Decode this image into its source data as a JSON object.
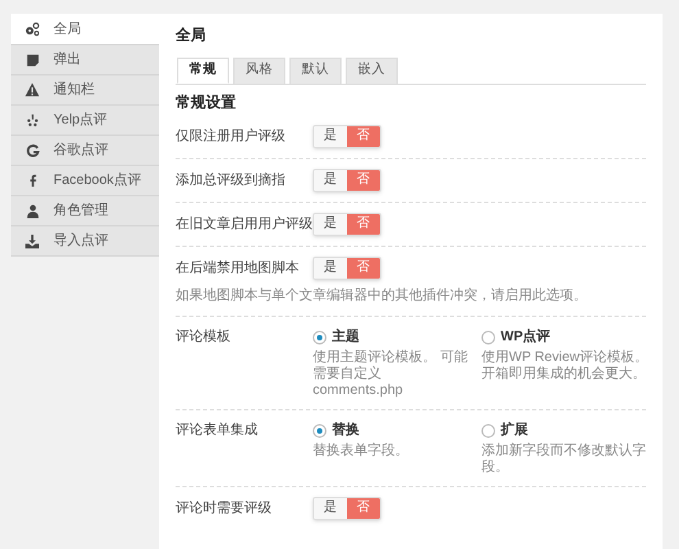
{
  "sidebar": {
    "items": [
      {
        "label": "全局",
        "selected": true
      },
      {
        "label": "弹出",
        "selected": false
      },
      {
        "label": "通知栏",
        "selected": false
      },
      {
        "label": "Yelp点评",
        "selected": false
      },
      {
        "label": "谷歌点评",
        "selected": false
      },
      {
        "label": "Facebook点评",
        "selected": false
      },
      {
        "label": "角色管理",
        "selected": false
      },
      {
        "label": "导入点评",
        "selected": false
      }
    ]
  },
  "panel": {
    "title": "全局",
    "tabs": [
      {
        "label": "常规",
        "selected": true
      },
      {
        "label": "风格",
        "selected": false
      },
      {
        "label": "默认",
        "selected": false
      },
      {
        "label": "嵌入",
        "selected": false
      }
    ],
    "section_title": "常规设置",
    "settings": [
      {
        "kind": "toggle",
        "label": "仅限注册用户评级",
        "yes": "是",
        "no": "否",
        "on": false
      },
      {
        "kind": "toggle",
        "label": "添加总评级到摘指",
        "yes": "是",
        "no": "否",
        "on": false
      },
      {
        "kind": "toggle",
        "label": "在旧文章启用用户评级",
        "yes": "是",
        "no": "否",
        "on": false
      },
      {
        "kind": "toggle",
        "label": "在后端禁用地图脚本",
        "yes": "是",
        "no": "否",
        "on": false,
        "note": "如果地图脚本与单个文章编辑器中的其他插件冲突，请启用此选项。"
      },
      {
        "kind": "radio",
        "label": "评论模板",
        "options": [
          {
            "label": "主题",
            "description": "使用主题评论模板。 可能需要自定义 comments.php",
            "selected": true
          },
          {
            "label": "WP点评",
            "description": "使用WP Review评论模板。开箱即用集成的机会更大。",
            "selected": false
          }
        ]
      },
      {
        "kind": "radio",
        "label": "评论表单集成",
        "options": [
          {
            "label": "替换",
            "description": "替换表单字段。",
            "selected": true
          },
          {
            "label": "扩展",
            "description": "添加新字段而不修改默认字段。",
            "selected": false
          }
        ]
      },
      {
        "kind": "toggle",
        "label": "评论时需要评级",
        "yes": "是",
        "no": "否",
        "on": false
      }
    ]
  }
}
